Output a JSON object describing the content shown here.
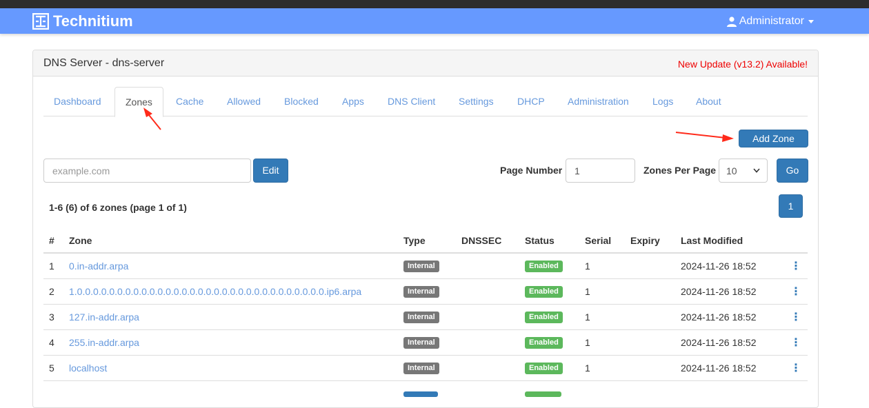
{
  "app": {
    "brand": "Technitium",
    "user": "Administrator"
  },
  "panel": {
    "title": "DNS Server - dns-server",
    "update_notice": "New Update (v13.2) Available!"
  },
  "tabs": [
    {
      "label": "Dashboard"
    },
    {
      "label": "Zones"
    },
    {
      "label": "Cache"
    },
    {
      "label": "Allowed"
    },
    {
      "label": "Blocked"
    },
    {
      "label": "Apps"
    },
    {
      "label": "DNS Client"
    },
    {
      "label": "Settings"
    },
    {
      "label": "DHCP"
    },
    {
      "label": "Administration"
    },
    {
      "label": "Logs"
    },
    {
      "label": "About"
    }
  ],
  "active_tab": "Zones",
  "toolbar": {
    "add_zone_label": "Add Zone",
    "zone_placeholder": "example.com",
    "edit_label": "Edit",
    "page_number_label": "Page Number",
    "page_number_value": "1",
    "zones_per_page_label": "Zones Per Page",
    "zones_per_page_value": "10",
    "go_label": "Go"
  },
  "summary": "1-6 (6) of 6 zones (page 1 of 1)",
  "pagination": {
    "current": "1"
  },
  "table": {
    "headers": [
      "#",
      "Zone",
      "Type",
      "DNSSEC",
      "Status",
      "Serial",
      "Expiry",
      "Last Modified"
    ],
    "rows": [
      {
        "num": "1",
        "zone": "0.in-addr.arpa",
        "type": "Internal",
        "dnssec": "",
        "status": "Enabled",
        "serial": "1",
        "expiry": "",
        "modified": "2024-11-26 18:52"
      },
      {
        "num": "2",
        "zone": "1.0.0.0.0.0.0.0.0.0.0.0.0.0.0.0.0.0.0.0.0.0.0.0.0.0.0.0.0.0.0.0.ip6.arpa",
        "type": "Internal",
        "dnssec": "",
        "status": "Enabled",
        "serial": "1",
        "expiry": "",
        "modified": "2024-11-26 18:52"
      },
      {
        "num": "3",
        "zone": "127.in-addr.arpa",
        "type": "Internal",
        "dnssec": "",
        "status": "Enabled",
        "serial": "1",
        "expiry": "",
        "modified": "2024-11-26 18:52"
      },
      {
        "num": "4",
        "zone": "255.in-addr.arpa",
        "type": "Internal",
        "dnssec": "",
        "status": "Enabled",
        "serial": "1",
        "expiry": "",
        "modified": "2024-11-26 18:52"
      },
      {
        "num": "5",
        "zone": "localhost",
        "type": "Internal",
        "dnssec": "",
        "status": "Enabled",
        "serial": "1",
        "expiry": "",
        "modified": "2024-11-26 18:52"
      }
    ]
  },
  "colors": {
    "navbar": "#6699ff",
    "link": "#6699dd",
    "primary": "#337ab7",
    "update": "#ee0000",
    "annotation": "#ff2a1a"
  }
}
